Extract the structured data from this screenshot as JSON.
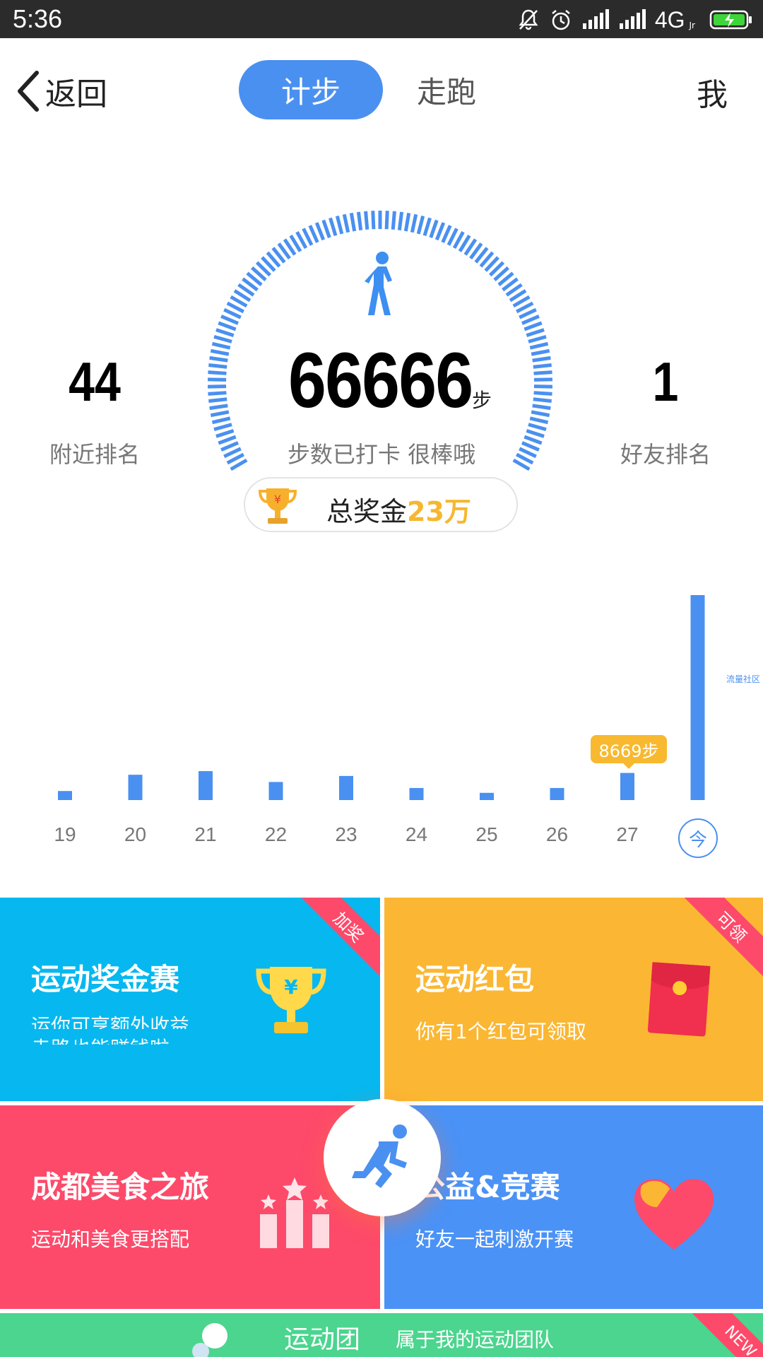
{
  "status_bar": {
    "time": "5:36",
    "network": "4G",
    "network_sub": "Jr"
  },
  "nav": {
    "back_label": "返回",
    "tabs": [
      {
        "label": "计步"
      },
      {
        "label": "走跑"
      }
    ],
    "me_label": "我"
  },
  "stats": {
    "steps": "66666",
    "steps_unit": "步",
    "checkin_text": "步数已打卡  很棒哦",
    "nearby_rank": {
      "value": "44",
      "label": "附近排名"
    },
    "friend_rank": {
      "value": "1",
      "label": "好友排名"
    },
    "prize": {
      "prefix": "总奖金",
      "amount": "23万"
    }
  },
  "chart_data": {
    "type": "bar",
    "categories": [
      "19",
      "20",
      "21",
      "22",
      "23",
      "24",
      "25",
      "26",
      "27",
      "今"
    ],
    "values": [
      1500,
      4200,
      4800,
      3000,
      4000,
      2000,
      1200,
      2000,
      4500,
      34000
    ],
    "highlight": {
      "index": 8,
      "label": "8669步"
    },
    "today_label": "今",
    "side_tag": "流量社区",
    "bar_color": "#4a90f0"
  },
  "cards": [
    {
      "title": "运动奖金赛",
      "subtitle_line1": "运你可享额外收益",
      "subtitle_line2": "走路也能赚钱啦",
      "ribbon": "加奖",
      "color": "#06b8ef"
    },
    {
      "title": "运动红包",
      "subtitle": "你有1个红包可领取",
      "ribbon": "可领",
      "color": "#fbb733"
    },
    {
      "title": "成都美食之旅",
      "subtitle": "运动和美食更搭配",
      "color": "#fd4a6a"
    },
    {
      "title": "公益&竞赛",
      "subtitle": "好友一起刺激开赛",
      "color": "#4a92f6"
    },
    {
      "title": "运动团",
      "subtitle": "属于我的运动团队",
      "ribbon": "NEW",
      "color": "#4bd58e"
    }
  ]
}
